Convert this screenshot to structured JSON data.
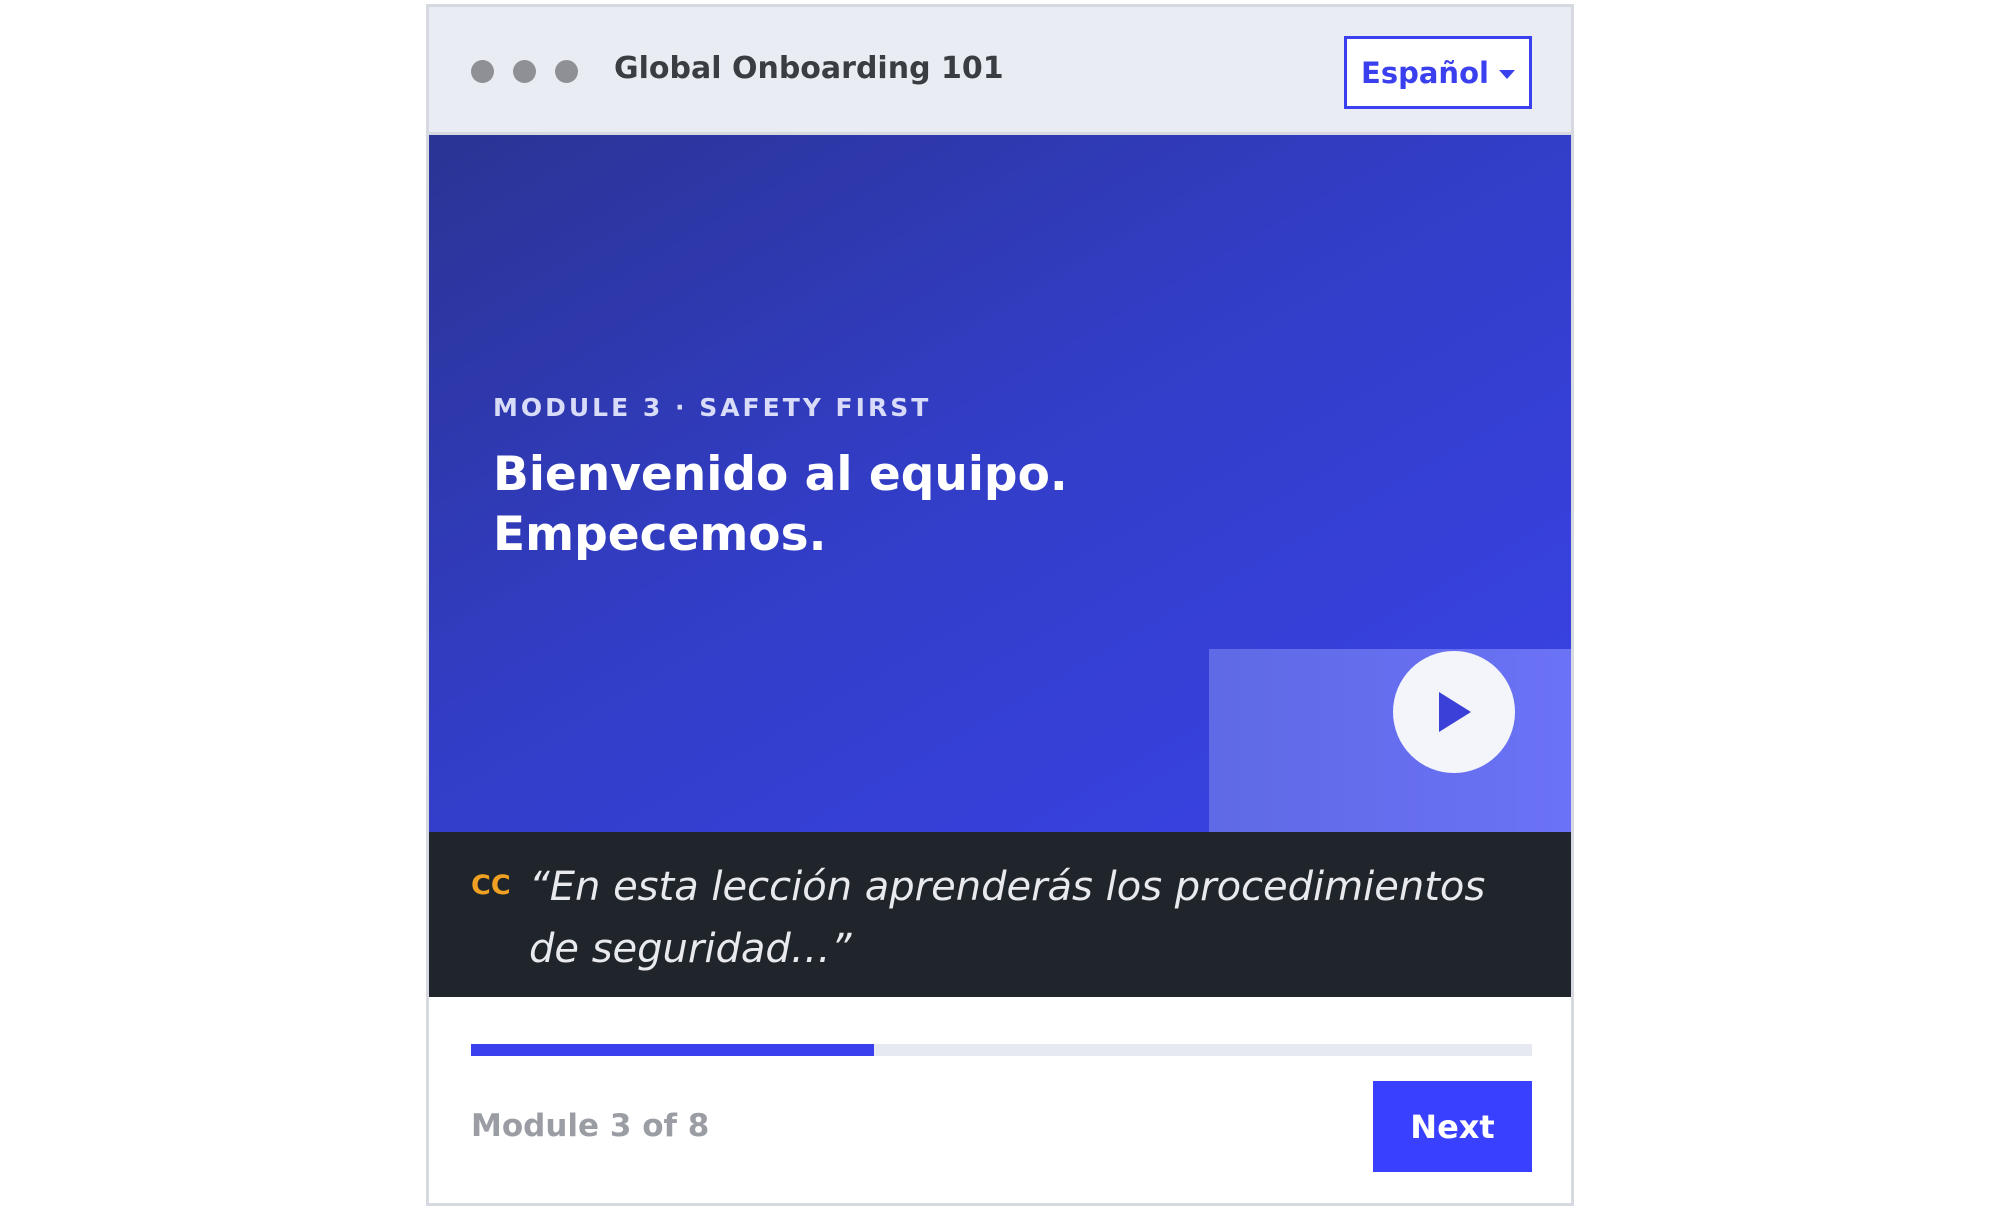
{
  "window": {
    "title": "Global Onboarding 101",
    "language_select": {
      "selected": "Español"
    }
  },
  "video": {
    "kicker": "MODULE 3 · SAFETY FIRST",
    "headline": "Bienvenido al equipo. Empecemos.",
    "play_icon": "play-icon"
  },
  "captions": {
    "badge": "CC",
    "text": "“En esta lección aprenderás los procedimientos de seguridad…”"
  },
  "footer": {
    "progress_fraction": 0.38,
    "module_label": "Module 3 of 8",
    "next_label": "Next"
  },
  "colors": {
    "accent": "#3a40ee",
    "caption_bg": "#1f252b",
    "cc_badge": "#f0a023"
  }
}
